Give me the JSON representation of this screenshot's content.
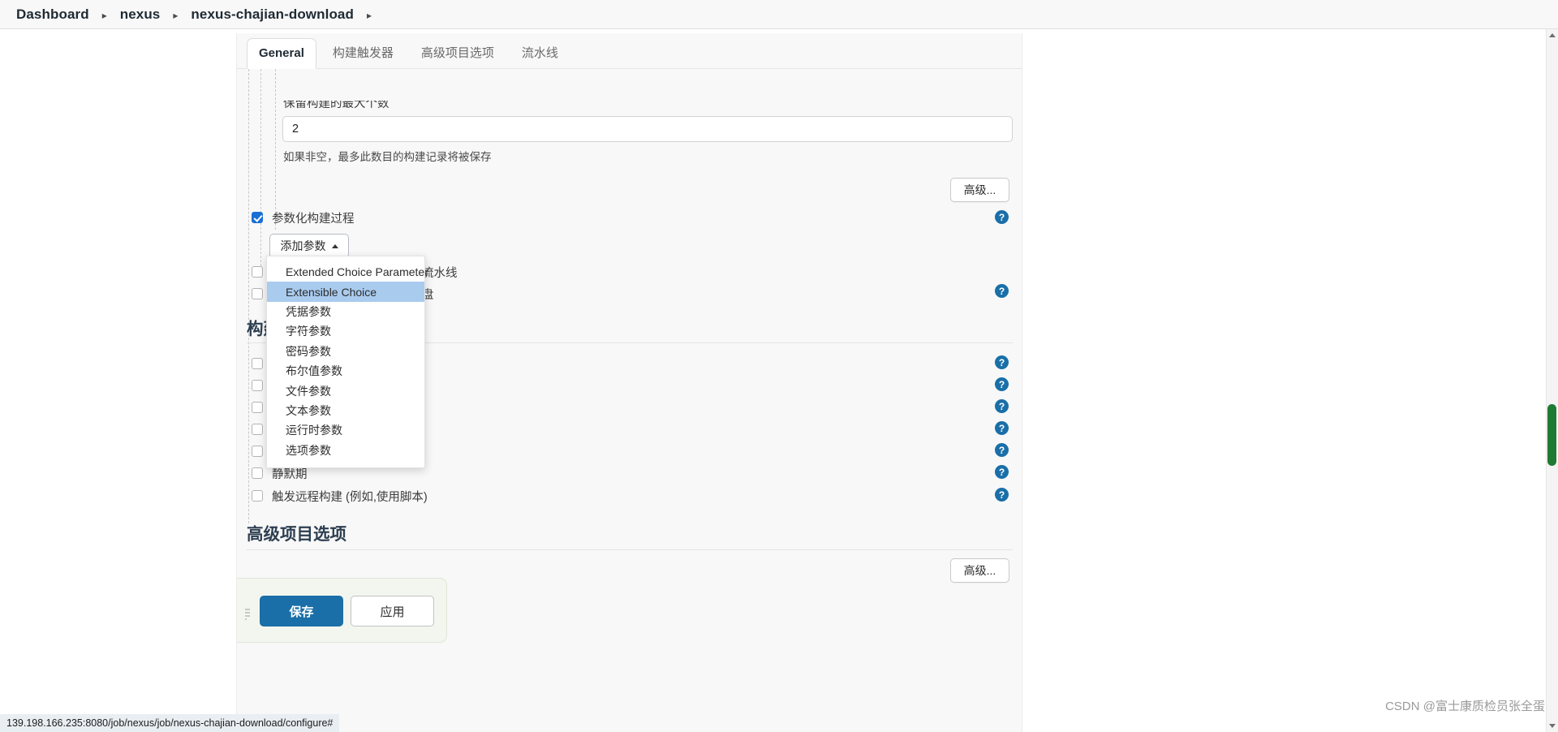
{
  "breadcrumb": {
    "items": [
      "Dashboard",
      "nexus",
      "nexus-chajian-download"
    ],
    "separator": "▸"
  },
  "tabs": [
    {
      "label": "General",
      "active": true
    },
    {
      "label": "构建触发器",
      "active": false
    },
    {
      "label": "高级项目选项",
      "active": false
    },
    {
      "label": "流水线",
      "active": false
    }
  ],
  "form": {
    "keep_builds_label": "保留构建的最大个数",
    "keep_builds_value": "2",
    "keep_builds_placeholder": "",
    "keep_builds_help": "如果非空，最多此数目的构建记录将被保存",
    "advanced_button_top": "高级...",
    "advanced_button_bottom": "高级...",
    "parameterized_label": "参数化构建过程",
    "add_param_button": "添加参数",
    "hidden_row_1": "流水线",
    "hidden_row_2": "盘",
    "quiet_period_label": "静默期",
    "remote_trigger_label": "触发远程构建 (例如,使用脚本)",
    "build_section_heading": "构建",
    "advanced_section_heading": "高级项目选项",
    "help_glyph": "?"
  },
  "add_param_dropdown": {
    "items": [
      {
        "label": "Extended Choice Parameter",
        "highlighted": false
      },
      {
        "label": "Extensible Choice",
        "highlighted": true
      },
      {
        "label": "凭据参数",
        "highlighted": false
      },
      {
        "label": "字符参数",
        "highlighted": false
      },
      {
        "label": "密码参数",
        "highlighted": false
      },
      {
        "label": "布尔值参数",
        "highlighted": false
      },
      {
        "label": "文件参数",
        "highlighted": false
      },
      {
        "label": "文本参数",
        "highlighted": false
      },
      {
        "label": "运行时参数",
        "highlighted": false
      },
      {
        "label": "选项参数",
        "highlighted": false
      }
    ]
  },
  "actions": {
    "save_label": "保存",
    "apply_label": "应用"
  },
  "status_bar": {
    "url": "139.198.166.235:8080/job/nexus/job/nexus-chajian-download/configure#"
  },
  "watermark": {
    "text": "CSDN @富士康质检员张全蛋"
  },
  "colors": {
    "accent": "#1a6fa8",
    "checkbox_checked": "#1a6fd4",
    "dropdown_highlight": "#a9cbee",
    "scrollbar_thumb": "#1f7a33"
  }
}
